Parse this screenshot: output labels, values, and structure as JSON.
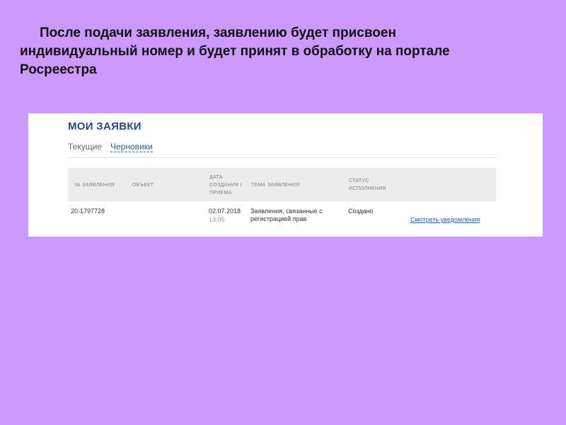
{
  "slide": {
    "text_lines": [
      "После подачи заявления, заявлению будет присвоен",
      "индивидуальный номер и будет принят в обработку на портале",
      "Росреестра"
    ]
  },
  "page": {
    "title": "МОИ ЗАЯВКИ",
    "tabs": [
      {
        "label": "Текущие",
        "active": false
      },
      {
        "label": "Черновики",
        "active": true
      }
    ]
  },
  "table": {
    "columns": {
      "number": "№ ЗАЯВЛЕНИЯ",
      "object": "ОБЪЕКТ",
      "date": "ДАТА СОЗДАНИЯ / ПРИЕМА",
      "topic": "ТЕМА ЗАЯВЛЕНИЯ",
      "status": "СТАТУС ИСПОЛНЕНИЯ"
    },
    "rows": [
      {
        "number": "20-1797728",
        "object": "",
        "date": "02.07.2018",
        "time": "13:05",
        "topic": "Заявления, связанные с регистрацией прав",
        "status": "Создано",
        "action": "Смотреть уведомления"
      }
    ]
  },
  "colors": {
    "slide_background": "#cc99ff",
    "heading": "#2a4a7a",
    "link": "#2b5f9e",
    "table_header_bg": "#ececec"
  }
}
